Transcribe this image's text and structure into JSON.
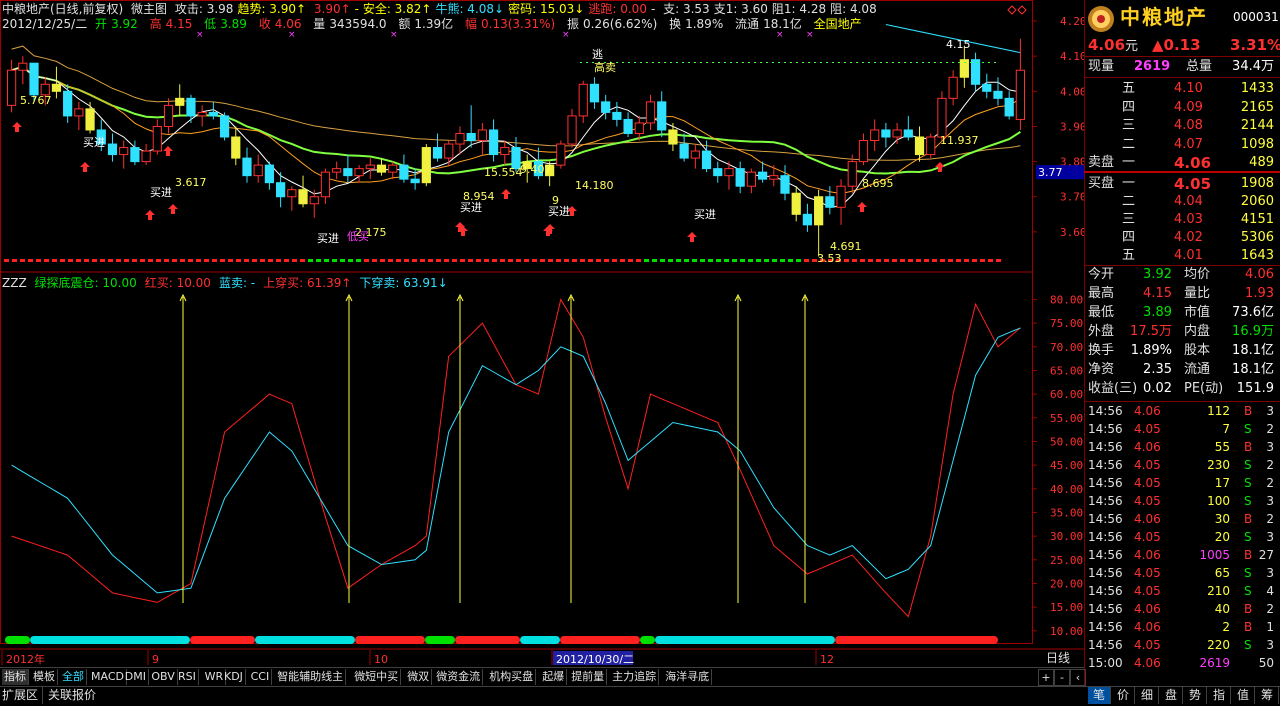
{
  "header": {
    "stock_title": "中粮地产(日线,前复权)",
    "chart_name": "微主图",
    "items": [
      {
        "label": "攻击:",
        "value": "3.98",
        "color": "w"
      },
      {
        "label": "趋势:",
        "value": "3.90↑",
        "color": "y"
      },
      {
        "label": "",
        "value": "3.90↑",
        "color": "r"
      },
      {
        "label": "- 安全:",
        "value": "3.82↑",
        "color": "y"
      },
      {
        "label": "牛熊:",
        "value": "4.08↓",
        "color": "c"
      },
      {
        "label": "密码:",
        "value": "15.03↓",
        "color": "y"
      },
      {
        "label": "逃跑:",
        "value": "0.00",
        "color": "r"
      },
      {
        "label": "-",
        "value": "",
        "color": "w"
      },
      {
        "label": "支:",
        "value": "3.53",
        "color": "w"
      },
      {
        "label": "支1:",
        "value": "3.60",
        "color": "w"
      },
      {
        "label": "阻1:",
        "value": "4.28",
        "color": "w"
      },
      {
        "label": "阻:",
        "value": "4.08",
        "color": "w"
      }
    ],
    "line2": {
      "date": "2012/12/25/二",
      "open_label": "开",
      "open": "3.92",
      "high_label": "高",
      "high": "4.15",
      "low_label": "低",
      "low": "3.89",
      "close_label": "收",
      "close": "4.06",
      "vol_label": "量",
      "vol": "343594.0",
      "amt_label": "额",
      "amt": "1.39亿",
      "chg_label": "幅",
      "chg": "0.13(3.31%)",
      "amp_label": "振",
      "amp": "0.26(6.62%)",
      "turn_label": "换",
      "turn": "1.89%",
      "float_label": "流通",
      "float": "18.1亿",
      "region": "全国地产"
    }
  },
  "indicator_header": {
    "name": "ZZZ",
    "items": [
      {
        "text": "绿探底震仓: 10.00",
        "color": "g"
      },
      {
        "text": "红买: 10.00",
        "color": "r"
      },
      {
        "text": "蓝卖: -",
        "color": "c"
      },
      {
        "text": "上穿买: 61.39↑",
        "color": "r"
      },
      {
        "text": "下穿卖: 63.91↓",
        "color": "c"
      }
    ]
  },
  "chart_data": {
    "type": "candlestick",
    "price_axis": {
      "ticks": [
        "4.20",
        "4.10",
        "4.00",
        "3.90",
        "3.80",
        "3.70",
        "3.60"
      ],
      "marker": "3.77"
    },
    "indicator_axis": {
      "ticks": [
        "80.00",
        "75.00",
        "70.00",
        "65.00",
        "60.00",
        "55.00",
        "50.00",
        "45.00",
        "40.00",
        "35.00",
        "30.00",
        "25.00",
        "20.00",
        "15.00",
        "10.00"
      ]
    },
    "x_labels": [
      "2012年",
      "9",
      "10",
      "2012/10/30/二",
      "12"
    ],
    "candles": [
      [
        3.96,
        4.09,
        3.94,
        4.06
      ],
      [
        4.06,
        4.1,
        4.02,
        4.08
      ],
      [
        4.08,
        4.08,
        3.97,
        3.99
      ],
      [
        3.99,
        4.04,
        3.96,
        4.02
      ],
      [
        4.02,
        4.07,
        3.98,
        4.0
      ],
      [
        4.0,
        4.02,
        3.91,
        3.93
      ],
      [
        3.93,
        3.97,
        3.89,
        3.95
      ],
      [
        3.95,
        3.97,
        3.88,
        3.89
      ],
      [
        3.89,
        3.92,
        3.83,
        3.85
      ],
      [
        3.85,
        3.88,
        3.8,
        3.82
      ],
      [
        3.82,
        3.86,
        3.78,
        3.84
      ],
      [
        3.84,
        3.86,
        3.79,
        3.8
      ],
      [
        3.8,
        3.85,
        3.79,
        3.83
      ],
      [
        3.83,
        3.92,
        3.82,
        3.9
      ],
      [
        3.9,
        3.98,
        3.88,
        3.96
      ],
      [
        3.96,
        4.02,
        3.93,
        3.98
      ],
      [
        3.98,
        3.99,
        3.91,
        3.93
      ],
      [
        3.93,
        3.96,
        3.9,
        3.94
      ],
      [
        3.94,
        3.97,
        3.92,
        3.93
      ],
      [
        3.93,
        3.94,
        3.86,
        3.87
      ],
      [
        3.87,
        3.9,
        3.79,
        3.81
      ],
      [
        3.81,
        3.84,
        3.74,
        3.76
      ],
      [
        3.76,
        3.82,
        3.74,
        3.79
      ],
      [
        3.79,
        3.8,
        3.72,
        3.74
      ],
      [
        3.74,
        3.77,
        3.67,
        3.7
      ],
      [
        3.7,
        3.73,
        3.66,
        3.72
      ],
      [
        3.72,
        3.76,
        3.67,
        3.68
      ],
      [
        3.68,
        3.72,
        3.64,
        3.7
      ],
      [
        3.7,
        3.78,
        3.68,
        3.77
      ],
      [
        3.77,
        3.8,
        3.75,
        3.78
      ],
      [
        3.78,
        3.82,
        3.74,
        3.76
      ],
      [
        3.76,
        3.79,
        3.74,
        3.78
      ],
      [
        3.78,
        3.81,
        3.75,
        3.79
      ],
      [
        3.79,
        3.81,
        3.76,
        3.77
      ],
      [
        3.77,
        3.8,
        3.75,
        3.79
      ],
      [
        3.79,
        3.82,
        3.74,
        3.75
      ],
      [
        3.75,
        3.78,
        3.72,
        3.74
      ],
      [
        3.74,
        3.85,
        3.73,
        3.84
      ],
      [
        3.84,
        3.88,
        3.8,
        3.81
      ],
      [
        3.81,
        3.86,
        3.79,
        3.85
      ],
      [
        3.85,
        3.9,
        3.82,
        3.88
      ],
      [
        3.88,
        3.96,
        3.84,
        3.86
      ],
      [
        3.86,
        3.91,
        3.82,
        3.89
      ],
      [
        3.89,
        3.92,
        3.8,
        3.82
      ],
      [
        3.82,
        3.86,
        3.79,
        3.84
      ],
      [
        3.84,
        3.87,
        3.77,
        3.78
      ],
      [
        3.78,
        3.82,
        3.74,
        3.8
      ],
      [
        3.8,
        3.84,
        3.75,
        3.76
      ],
      [
        3.76,
        3.8,
        3.73,
        3.79
      ],
      [
        3.79,
        3.86,
        3.78,
        3.85
      ],
      [
        3.85,
        3.95,
        3.84,
        3.93
      ],
      [
        3.93,
        4.03,
        3.91,
        4.02
      ],
      [
        4.02,
        4.04,
        3.95,
        3.97
      ],
      [
        3.97,
        3.99,
        3.92,
        3.94
      ],
      [
        3.94,
        3.97,
        3.9,
        3.92
      ],
      [
        3.92,
        3.94,
        3.87,
        3.88
      ],
      [
        3.88,
        3.93,
        3.86,
        3.91
      ],
      [
        3.91,
        3.99,
        3.89,
        3.97
      ],
      [
        3.97,
        4.0,
        3.87,
        3.89
      ],
      [
        3.89,
        3.91,
        3.83,
        3.85
      ],
      [
        3.85,
        3.88,
        3.8,
        3.81
      ],
      [
        3.81,
        3.85,
        3.78,
        3.83
      ],
      [
        3.83,
        3.86,
        3.77,
        3.78
      ],
      [
        3.78,
        3.8,
        3.74,
        3.76
      ],
      [
        3.76,
        3.8,
        3.72,
        3.78
      ],
      [
        3.78,
        3.8,
        3.71,
        3.73
      ],
      [
        3.73,
        3.78,
        3.71,
        3.77
      ],
      [
        3.77,
        3.8,
        3.74,
        3.75
      ],
      [
        3.75,
        3.79,
        3.73,
        3.76
      ],
      [
        3.76,
        3.79,
        3.69,
        3.71
      ],
      [
        3.71,
        3.73,
        3.63,
        3.65
      ],
      [
        3.65,
        3.68,
        3.6,
        3.62
      ],
      [
        3.62,
        3.72,
        3.53,
        3.7
      ],
      [
        3.7,
        3.73,
        3.65,
        3.67
      ],
      [
        3.67,
        3.75,
        3.62,
        3.73
      ],
      [
        3.73,
        3.82,
        3.71,
        3.8
      ],
      [
        3.8,
        3.88,
        3.79,
        3.86
      ],
      [
        3.86,
        3.92,
        3.83,
        3.89
      ],
      [
        3.89,
        3.91,
        3.84,
        3.87
      ],
      [
        3.87,
        3.91,
        3.85,
        3.89
      ],
      [
        3.89,
        3.93,
        3.86,
        3.87
      ],
      [
        3.87,
        3.9,
        3.8,
        3.82
      ],
      [
        3.82,
        3.88,
        3.81,
        3.87
      ],
      [
        3.87,
        4.0,
        3.86,
        3.98
      ],
      [
        3.98,
        4.06,
        3.96,
        4.04
      ],
      [
        4.04,
        4.13,
        4.01,
        4.09
      ],
      [
        4.09,
        4.11,
        4.0,
        4.02
      ],
      [
        4.02,
        4.05,
        3.98,
        4.0
      ],
      [
        4.0,
        4.04,
        3.96,
        3.98
      ],
      [
        3.98,
        4.0,
        3.92,
        3.93
      ],
      [
        3.92,
        4.15,
        3.89,
        4.06
      ]
    ],
    "annotations": [
      {
        "text": "5.767",
        "color": "#ffff60"
      },
      {
        "text": "3.617",
        "color": "#ffff60"
      },
      {
        "text": "2.175",
        "color": "#ffff60"
      },
      {
        "text": "8.954",
        "color": "#ffff60"
      },
      {
        "text": "15.554",
        "color": "#ffff60"
      },
      {
        "text": "9.407",
        "color": "#ffff60"
      },
      {
        "text": "9",
        "color": "#ffff60"
      },
      {
        "text": "14.180",
        "color": "#ffff60"
      },
      {
        "text": "8.695",
        "color": "#ffff60"
      },
      {
        "text": "4.691",
        "color": "#ffff60"
      },
      {
        "text": "3.53",
        "color": "#ffff60"
      },
      {
        "text": "11.937",
        "color": "#ffff60"
      },
      {
        "text": "4.15",
        "color": "#ffffff"
      },
      {
        "text": "买进",
        "color": "#ffffff"
      },
      {
        "text": "买进",
        "color": "#ffffff"
      },
      {
        "text": "买进",
        "color": "#ffffff"
      },
      {
        "text": "买进",
        "color": "#ffffff"
      },
      {
        "text": "买进",
        "color": "#ffffff"
      },
      {
        "text": "买进",
        "color": "#ffffff"
      },
      {
        "text": "低买",
        "color": "#ff40ff"
      },
      {
        "text": "逃",
        "color": "#ffffff"
      },
      {
        "text": "高卖",
        "color": "#ffff60"
      }
    ]
  },
  "quote": {
    "name_logo": "中粮地产",
    "code": "000031",
    "price": "4.06",
    "price_unit": "元",
    "change": "▲0.13",
    "change_pct": "3.31%",
    "vol_now_label": "现量",
    "vol_now": "2619",
    "total_vol_label": "总量",
    "total_vol": "34.4万",
    "asks": [
      {
        "level": "五",
        "price": "4.10",
        "vol": "1433"
      },
      {
        "level": "四",
        "price": "4.09",
        "vol": "2165"
      },
      {
        "level": "三",
        "price": "4.08",
        "vol": "2144"
      },
      {
        "level": "二",
        "price": "4.07",
        "vol": "1098"
      },
      {
        "level": "一",
        "price": "4.06",
        "vol": "489",
        "prefix": "卖盘"
      }
    ],
    "bids": [
      {
        "level": "一",
        "price": "4.05",
        "vol": "1908",
        "prefix": "买盘"
      },
      {
        "level": "二",
        "price": "4.04",
        "vol": "2060"
      },
      {
        "level": "三",
        "price": "4.03",
        "vol": "4151"
      },
      {
        "level": "四",
        "price": "4.02",
        "vol": "5306"
      },
      {
        "level": "五",
        "price": "4.01",
        "vol": "1643"
      }
    ],
    "stats": [
      {
        "l1": "今开",
        "v1": "3.92",
        "c1": "g",
        "l2": "均价",
        "v2": "4.06",
        "c2": "r"
      },
      {
        "l1": "最高",
        "v1": "4.15",
        "c1": "r",
        "l2": "量比",
        "v2": "1.93",
        "c2": "r"
      },
      {
        "l1": "最低",
        "v1": "3.89",
        "c1": "g",
        "l2": "市值",
        "v2": "73.6亿",
        "c2": "w"
      },
      {
        "l1": "外盘",
        "v1": "17.5万",
        "c1": "r",
        "l2": "内盘",
        "v2": "16.9万",
        "c2": "g"
      },
      {
        "l1": "换手",
        "v1": "1.89%",
        "c1": "w",
        "l2": "股本",
        "v2": "18.1亿",
        "c2": "w"
      },
      {
        "l1": "净资",
        "v1": "2.35",
        "c1": "w",
        "l2": "流通",
        "v2": "18.1亿",
        "c2": "w"
      },
      {
        "l1": "收益(三)",
        "v1": "0.02",
        "c1": "w",
        "l2": "PE(动)",
        "v2": "151.9",
        "c2": "w"
      }
    ],
    "ticks": [
      {
        "time": "14:56",
        "price": "4.06",
        "vol": "112",
        "bs": "B",
        "n": "3"
      },
      {
        "time": "14:56",
        "price": "4.05",
        "vol": "7",
        "bs": "S",
        "n": "2"
      },
      {
        "time": "14:56",
        "price": "4.06",
        "vol": "55",
        "bs": "B",
        "n": "3"
      },
      {
        "time": "14:56",
        "price": "4.05",
        "vol": "230",
        "bs": "S",
        "n": "2"
      },
      {
        "time": "14:56",
        "price": "4.05",
        "vol": "17",
        "bs": "S",
        "n": "2"
      },
      {
        "time": "14:56",
        "price": "4.05",
        "vol": "100",
        "bs": "S",
        "n": "3"
      },
      {
        "time": "14:56",
        "price": "4.06",
        "vol": "30",
        "bs": "B",
        "n": "2"
      },
      {
        "time": "14:56",
        "price": "4.05",
        "vol": "20",
        "bs": "S",
        "n": "3"
      },
      {
        "time": "14:56",
        "price": "4.06",
        "vol": "1005",
        "bs": "B",
        "n": "27"
      },
      {
        "time": "14:56",
        "price": "4.05",
        "vol": "65",
        "bs": "S",
        "n": "3"
      },
      {
        "time": "14:56",
        "price": "4.05",
        "vol": "210",
        "bs": "S",
        "n": "4"
      },
      {
        "time": "14:56",
        "price": "4.06",
        "vol": "40",
        "bs": "B",
        "n": "2"
      },
      {
        "time": "14:56",
        "price": "4.06",
        "vol": "2",
        "bs": "B",
        "n": "1"
      },
      {
        "time": "14:56",
        "price": "4.05",
        "vol": "220",
        "bs": "S",
        "n": "3"
      },
      {
        "time": "15:00",
        "price": "4.06",
        "vol": "2619",
        "bs": "",
        "n": "50"
      }
    ]
  },
  "tabs": [
    "指标",
    "模板",
    "全部",
    "MACD",
    "DMI",
    "OBV",
    "RSI",
    "WR",
    "KDJ",
    "CCI",
    "智能辅助线主",
    "微短中买",
    "微双",
    "微资金流",
    "机构买盘",
    "起爆",
    "提前量",
    "主力追踪",
    "海洋寻底"
  ],
  "bottom_left": [
    "扩展区",
    "关联报价"
  ],
  "period_label": "日线",
  "right_tabs": [
    "笔",
    "价",
    "细",
    "盘",
    "势",
    "指",
    "值",
    "筹"
  ],
  "colors": {
    "up": "#ff3030",
    "down": "#30e0ff",
    "yellow": "#ffff00",
    "border": "#800000"
  }
}
